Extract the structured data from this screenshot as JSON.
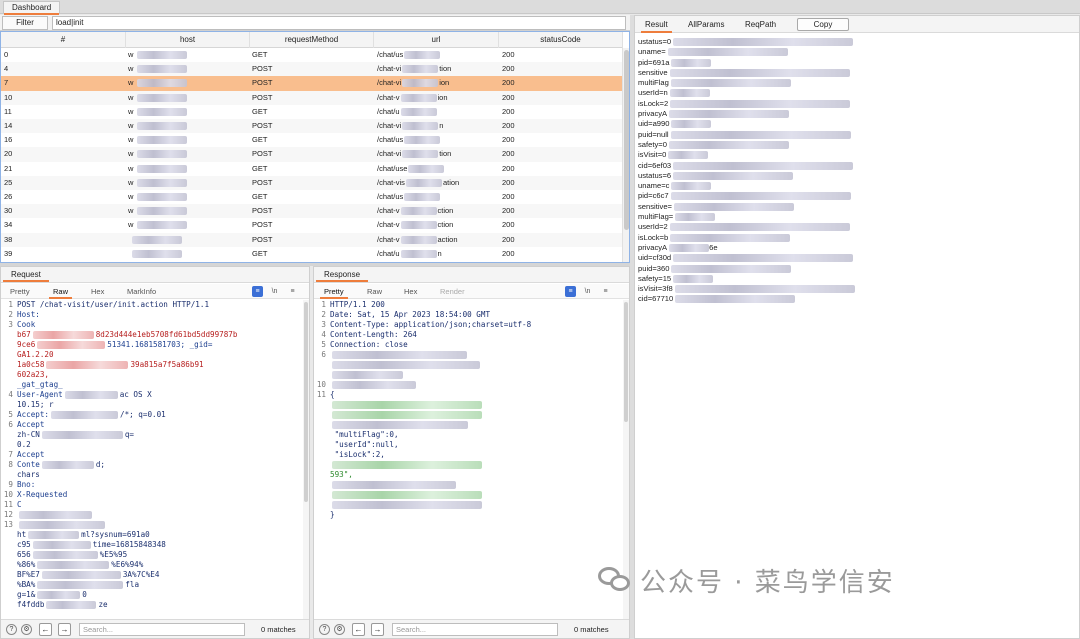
{
  "top_tab": "Dashboard",
  "filter": {
    "button": "Filter",
    "value": "load|init"
  },
  "table": {
    "columns": [
      "#",
      "host",
      "requestMethod",
      "url",
      "statusCode"
    ],
    "rows": [
      {
        "id": "0",
        "host": "w",
        "method": "GET",
        "url": "/chat/us",
        "url_tail": "",
        "status": "200"
      },
      {
        "id": "4",
        "host": "w",
        "method": "POST",
        "url": "/chat-vi",
        "url_tail": "tion",
        "status": "200"
      },
      {
        "id": "7",
        "host": "w",
        "method": "POST",
        "url": "/chat-vi",
        "url_tail": "ion",
        "status": "200"
      },
      {
        "id": "10",
        "host": "w",
        "method": "POST",
        "url": "/chat-v",
        "url_tail": "ion",
        "status": "200"
      },
      {
        "id": "11",
        "host": "w",
        "method": "GET",
        "url": "/chat/u",
        "url_tail": "",
        "status": "200"
      },
      {
        "id": "14",
        "host": "w",
        "method": "POST",
        "url": "/chat-vi",
        "url_tail": "n",
        "status": "200"
      },
      {
        "id": "16",
        "host": "w",
        "method": "GET",
        "url": "/chat/us",
        "url_tail": "",
        "status": "200"
      },
      {
        "id": "20",
        "host": "w",
        "method": "POST",
        "url": "/chat-vi",
        "url_tail": "tion",
        "status": "200"
      },
      {
        "id": "21",
        "host": "w",
        "method": "GET",
        "url": "/chat/use",
        "url_tail": "",
        "status": "200"
      },
      {
        "id": "25",
        "host": "w",
        "method": "POST",
        "url": "/chat-vis",
        "url_tail": "ation",
        "status": "200"
      },
      {
        "id": "26",
        "host": "w",
        "method": "GET",
        "url": "/chat/us",
        "url_tail": "",
        "status": "200"
      },
      {
        "id": "30",
        "host": "w",
        "method": "POST",
        "url": "/chat-v",
        "url_tail": "ction",
        "status": "200"
      },
      {
        "id": "34",
        "host": "w",
        "method": "POST",
        "url": "/chat-v",
        "url_tail": "ction",
        "status": "200"
      },
      {
        "id": "38",
        "host": "",
        "method": "POST",
        "url": "/chat-v",
        "url_tail": "action",
        "status": "200"
      },
      {
        "id": "39",
        "host": "",
        "method": "GET",
        "url": "/chat/u",
        "url_tail": "n",
        "status": "200"
      }
    ],
    "selected_row": "7",
    "selected_color": "#f9be8e"
  },
  "request": {
    "title": "Request",
    "tabs": [
      "Pretty",
      "Raw",
      "Hex",
      "MarkInfo"
    ],
    "active_tab": "Raw",
    "lines": [
      {
        "n": "1",
        "parts": [
          {
            "t": "POST /chat-visit/user/init.action HTTP/1.1",
            "c": "k-navy"
          }
        ]
      },
      {
        "n": "2",
        "parts": [
          {
            "t": "Host:",
            "c": "k-blue"
          }
        ]
      },
      {
        "n": "3",
        "parts": [
          {
            "t": "Cook",
            "c": "k-blue"
          }
        ]
      },
      {
        "n": "",
        "parts": [
          {
            "t": "b67",
            "c": "k-red"
          },
          {
            "t": "8d23d444e1eb5708fd61bd5dd99787b",
            "c": "k-red"
          }
        ]
      },
      {
        "n": "",
        "parts": [
          {
            "t": "9ce6",
            "c": "k-red"
          },
          {
            "t": "51341.1681581703; _gid=",
            "c": "k-blue"
          }
        ]
      },
      {
        "n": "",
        "parts": [
          {
            "t": "GA1.2.20",
            "c": "k-red"
          }
        ]
      },
      {
        "n": "",
        "parts": [
          {
            "t": "1a0c58",
            "c": "k-red"
          },
          {
            "t": "39a815a7f5a86b91",
            "c": "k-red"
          }
        ]
      },
      {
        "n": "",
        "parts": [
          {
            "t": "602a23,",
            "c": "k-red"
          }
        ]
      },
      {
        "n": "",
        "parts": [
          {
            "t": "_gat_gtag_",
            "c": "k-blue"
          }
        ]
      },
      {
        "n": "4",
        "parts": [
          {
            "t": "User-Agent",
            "c": "k-blue"
          },
          {
            "t": "ac OS X",
            "c": "k-navy"
          }
        ]
      },
      {
        "n": "",
        "parts": [
          {
            "t": "10.15; r",
            "c": "k-navy"
          }
        ]
      },
      {
        "n": "5",
        "parts": [
          {
            "t": "Accept:",
            "c": "k-blue"
          },
          {
            "t": "/*; q=0.01",
            "c": "k-navy"
          }
        ]
      },
      {
        "n": "6",
        "parts": [
          {
            "t": "Accept",
            "c": "k-blue"
          }
        ]
      },
      {
        "n": "",
        "parts": [
          {
            "t": "zh-CN",
            "c": "k-navy"
          },
          {
            "t": "q=",
            "c": "k-navy"
          }
        ]
      },
      {
        "n": "",
        "parts": [
          {
            "t": "0.2",
            "c": "k-navy"
          }
        ]
      },
      {
        "n": "7",
        "parts": [
          {
            "t": "Accept",
            "c": "k-blue"
          }
        ]
      },
      {
        "n": "8",
        "parts": [
          {
            "t": "Conte",
            "c": "k-blue"
          },
          {
            "t": "d;",
            "c": "k-navy"
          }
        ]
      },
      {
        "n": "",
        "parts": [
          {
            "t": "chars",
            "c": "k-navy"
          }
        ]
      },
      {
        "n": "9",
        "parts": [
          {
            "t": "Bno: ",
            "c": "k-blue"
          }
        ]
      },
      {
        "n": "10",
        "parts": [
          {
            "t": "X-Requested",
            "c": "k-blue"
          }
        ]
      },
      {
        "n": "11",
        "parts": [
          {
            "t": "C",
            "c": "k-blue"
          }
        ]
      },
      {
        "n": "12",
        "parts": [
          {
            "t": "",
            "c": "k-navy"
          }
        ]
      },
      {
        "n": "13",
        "parts": [
          {
            "t": "",
            "c": "k-navy"
          }
        ]
      },
      {
        "n": "",
        "parts": [
          {
            "t": "ht",
            "c": "k-navy"
          },
          {
            "t": "ml?sysnum=691a0",
            "c": "k-navy"
          }
        ]
      },
      {
        "n": "",
        "parts": [
          {
            "t": "c95",
            "c": "k-navy"
          },
          {
            "t": "time=16815848348",
            "c": "k-navy"
          }
        ]
      },
      {
        "n": "",
        "parts": [
          {
            "t": "656",
            "c": "k-navy"
          },
          {
            "t": "%E5%95",
            "c": "k-navy"
          }
        ]
      },
      {
        "n": "",
        "parts": [
          {
            "t": "%86%",
            "c": "k-navy"
          },
          {
            "t": "%E6%94%",
            "c": "k-navy"
          }
        ]
      },
      {
        "n": "",
        "parts": [
          {
            "t": "BF%E7",
            "c": "k-navy"
          },
          {
            "t": "3A%7C%E4",
            "c": "k-navy"
          }
        ]
      },
      {
        "n": "",
        "parts": [
          {
            "t": "%BA%",
            "c": "k-navy"
          },
          {
            "t": "fla",
            "c": "k-navy"
          }
        ]
      },
      {
        "n": "",
        "parts": [
          {
            "t": "g=1&",
            "c": "k-navy"
          },
          {
            "t": "0",
            "c": "k-navy"
          }
        ]
      },
      {
        "n": "",
        "parts": [
          {
            "t": "f4fddb",
            "c": "k-navy"
          },
          {
            "t": "ze",
            "c": "k-navy"
          }
        ]
      }
    ],
    "footer": {
      "search_placeholder": "Search...",
      "matches": "0 matches"
    }
  },
  "response": {
    "title": "Response",
    "tabs": [
      "Pretty",
      "Raw",
      "Hex",
      "Render"
    ],
    "active_tab": "Pretty",
    "lines": [
      {
        "n": "1",
        "parts": [
          {
            "t": "HTTP/1.1 200",
            "c": "k-navy"
          }
        ]
      },
      {
        "n": "2",
        "parts": [
          {
            "t": "Date: Sat, 15 Apr 2023 18:54:00 GMT",
            "c": "k-navy"
          }
        ]
      },
      {
        "n": "3",
        "parts": [
          {
            "t": "Content-Type: application/json;charset=utf-8",
            "c": "k-navy"
          }
        ]
      },
      {
        "n": "4",
        "parts": [
          {
            "t": "Content-Length: 264",
            "c": "k-navy"
          }
        ]
      },
      {
        "n": "5",
        "parts": [
          {
            "t": "Connection: close",
            "c": "k-navy"
          }
        ]
      },
      {
        "n": "6",
        "parts": [
          {
            "t": "",
            "c": "k-navy"
          }
        ]
      },
      {
        "n": "",
        "parts": [
          {
            "t": "",
            "c": "k-navy"
          }
        ]
      },
      {
        "n": "",
        "parts": [
          {
            "t": "",
            "c": "k-navy"
          }
        ]
      },
      {
        "n": "10",
        "parts": [
          {
            "t": "",
            "c": "k-navy"
          }
        ]
      },
      {
        "n": "11",
        "parts": [
          {
            "t": "{",
            "c": "k-navy"
          }
        ]
      },
      {
        "n": "",
        "parts": [
          {
            "t": "",
            "c": "k-navy"
          }
        ]
      },
      {
        "n": "",
        "parts": [
          {
            "t": "",
            "c": "k-navy"
          }
        ]
      },
      {
        "n": "",
        "parts": [
          {
            "t": "",
            "c": "k-navy"
          }
        ]
      },
      {
        "n": "",
        "parts": [
          {
            "t": "  \"multiFlag\":0,",
            "c": "k-navy"
          }
        ]
      },
      {
        "n": "",
        "parts": [
          {
            "t": "  \"userId\":null,",
            "c": "k-navy"
          }
        ]
      },
      {
        "n": "",
        "parts": [
          {
            "t": "  \"isLock\":2,",
            "c": "k-navy"
          }
        ]
      },
      {
        "n": "",
        "parts": [
          {
            "t": "",
            "c": "k-navy"
          }
        ]
      },
      {
        "n": "",
        "parts": [
          {
            "t": "593\",",
            "c": "k-grn"
          }
        ]
      },
      {
        "n": "",
        "parts": [
          {
            "t": "",
            "c": "k-navy"
          }
        ]
      },
      {
        "n": "",
        "parts": [
          {
            "t": "",
            "c": "k-navy"
          }
        ]
      },
      {
        "n": "",
        "parts": [
          {
            "t": "",
            "c": "k-navy"
          }
        ]
      },
      {
        "n": "",
        "parts": [
          {
            "t": "}",
            "c": "k-navy"
          }
        ]
      }
    ],
    "footer": {
      "search_placeholder": "Search...",
      "matches": "0 matches"
    }
  },
  "result": {
    "tabs": [
      "Result",
      "AllParams",
      "ReqPath"
    ],
    "active_tab": "Result",
    "copy_label": "Copy",
    "lines": [
      "ustatus=0",
      "uname=",
      "pid=691a",
      "sensitive",
      "multiFlag",
      "userId=n",
      "isLock=2",
      "privacyA",
      "uid=a990",
      "puid=null",
      "safety=0",
      "isVisit=0",
      "cid=6ef03",
      "ustatus=6",
      "uname=c",
      "pid=c6c7",
      "sensitive=",
      "multiFlag=",
      "userId=2",
      "isLock=b",
      "privacyA",
      "uid=cf30d",
      "puid=360",
      "safety=15",
      "isVisit=3f8",
      "cid=67710"
    ],
    "line_tails": [
      "",
      "",
      "",
      "",
      "",
      "",
      "",
      "",
      "",
      "",
      "",
      "",
      "",
      "",
      "",
      "",
      "",
      "",
      "",
      "",
      "6e",
      "",
      "",
      "",
      "",
      ""
    ]
  },
  "watermark": "公众号 · 菜鸟学信安"
}
